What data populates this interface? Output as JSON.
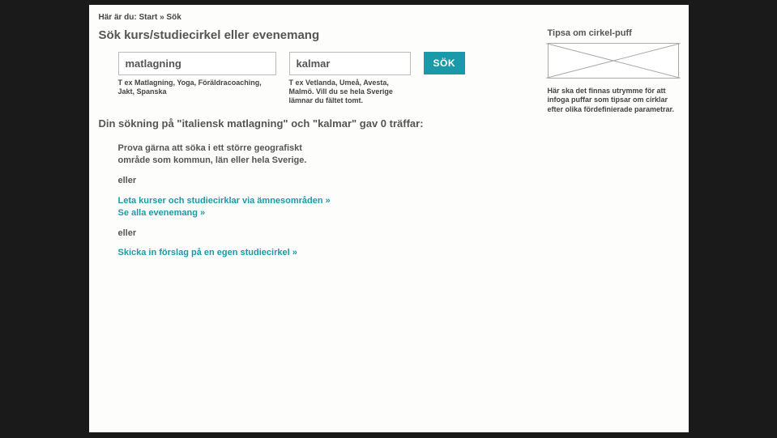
{
  "breadcrumb": "Här är du:   Start » Sök",
  "heading": "Sök kurs/studiecirkel eller evenemang",
  "search": {
    "subject_value": "matlagning",
    "subject_hint": "T ex Matlagning, Yoga, Föräldracoaching, Jakt, Spanska",
    "location_value": "kalmar",
    "location_hint": "T ex Vetlanda, Umeå, Avesta, Malmö. Vill du se hela Sverige lämnar du fältet tomt.",
    "button": "SÖK"
  },
  "result_text": "Din sökning på \"italiensk matlagning\" och \"kalmar\" gav 0 träffar:",
  "suggestions": {
    "tip": "Prova gärna att söka i ett större geografiskt område som kommun, län eller hela Sverige.",
    "or1": "eller",
    "link1": "Leta kurser och studiecirklar via ämnesområden »",
    "link2": "Se alla evenemang »",
    "or2": "eller",
    "link3": "Skicka in förslag på en egen studiecirkel  »"
  },
  "sidebar": {
    "title": "Tipsa om cirkel-puff",
    "note": "Här ska det finnas utrymme för att infoga puffar som tipsar om cirklar efter olika fördefinierade parametrar."
  }
}
